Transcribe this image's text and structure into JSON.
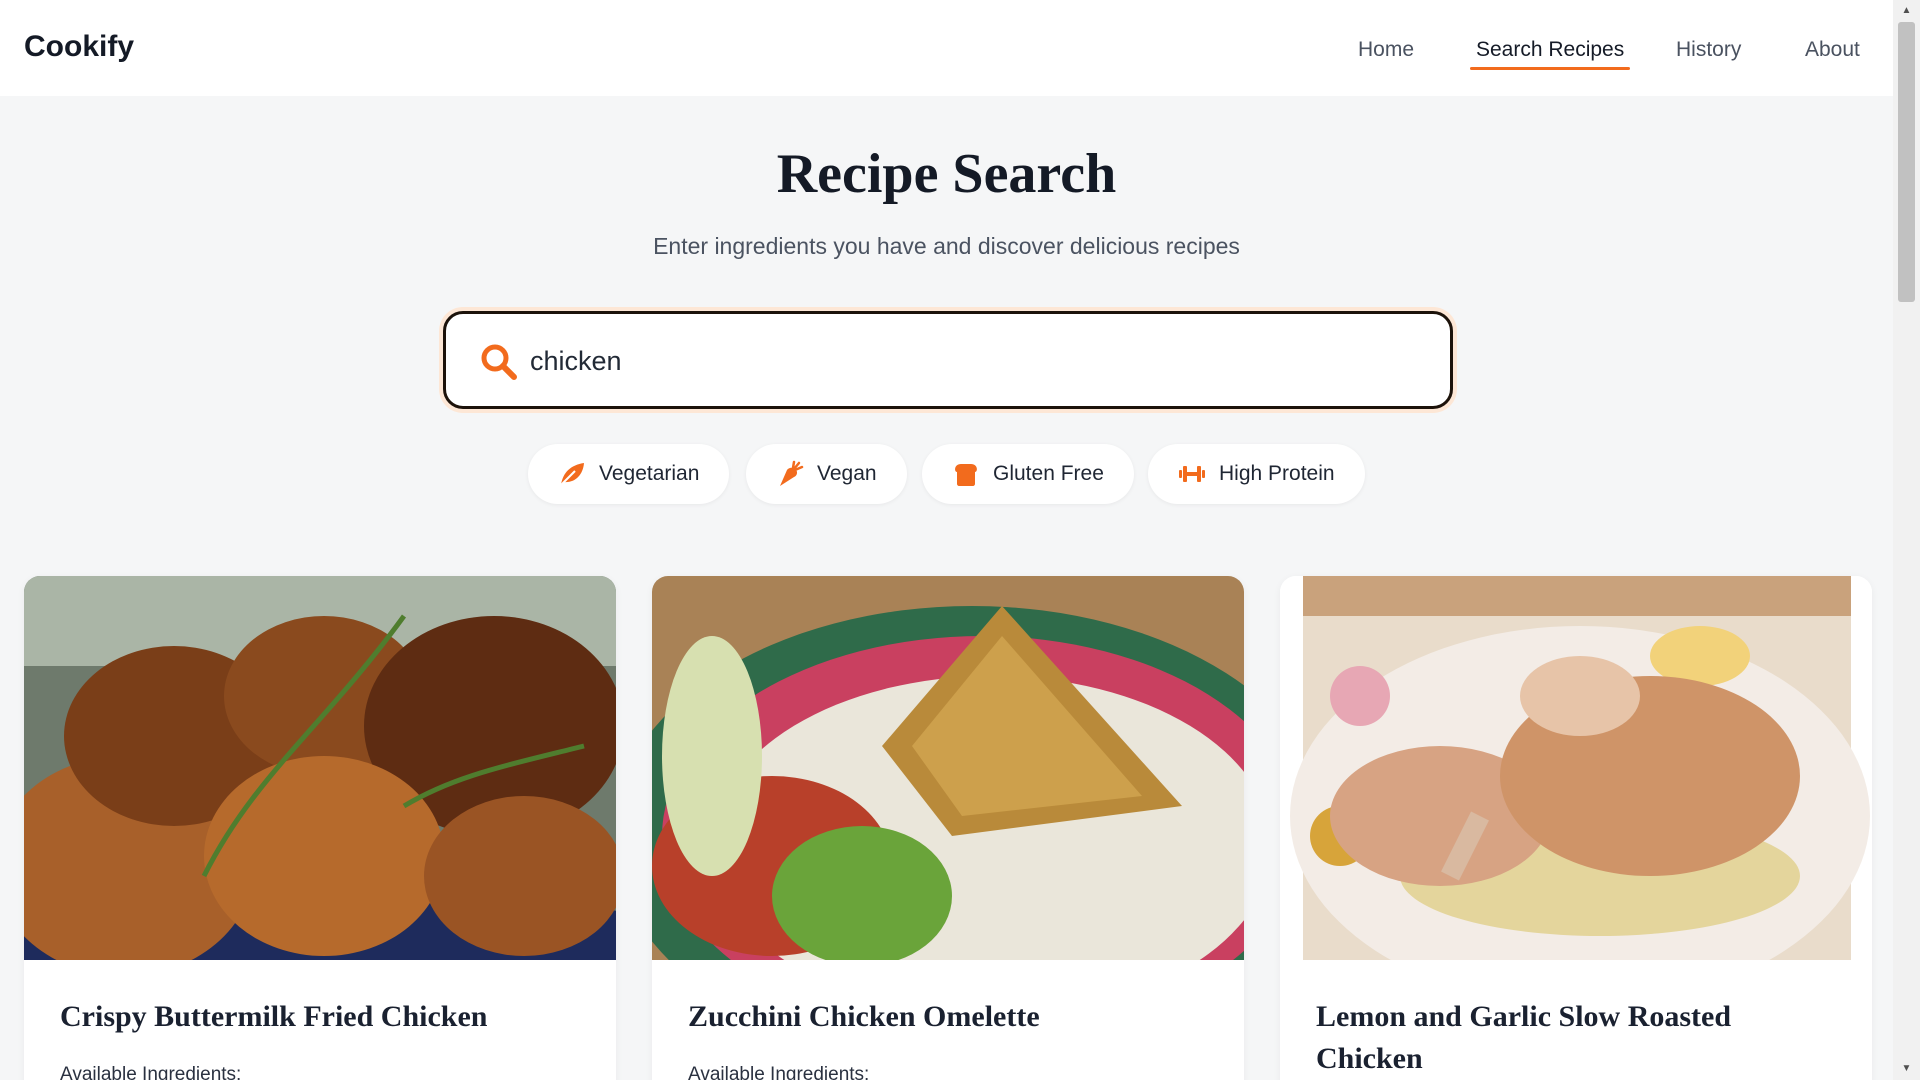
{
  "brand": "Cookify",
  "nav": {
    "items": [
      {
        "label": "Home",
        "active": false
      },
      {
        "label": "Search Recipes",
        "active": true
      },
      {
        "label": "History",
        "active": false
      },
      {
        "label": "About",
        "active": false
      }
    ]
  },
  "header": {
    "title": "Recipe Search",
    "subtitle": "Enter ingredients you have and discover delicious recipes"
  },
  "search": {
    "value": "chicken",
    "icon": "search-icon"
  },
  "filters": [
    {
      "label": "Vegetarian",
      "icon": "leaf-icon"
    },
    {
      "label": "Vegan",
      "icon": "carrot-icon"
    },
    {
      "label": "Gluten Free",
      "icon": "bread-icon"
    },
    {
      "label": "High Protein",
      "icon": "dumbbell-icon"
    }
  ],
  "recipes": [
    {
      "title": "Crispy Buttermilk Fried Chicken",
      "ingredients_label": "Available Ingredients:"
    },
    {
      "title": "Zucchini Chicken Omelette",
      "ingredients_label": "Available Ingredients:"
    },
    {
      "title": "Lemon and Garlic Slow Roasted Chicken",
      "ingredients_label": ""
    }
  ],
  "colors": {
    "accent": "#f26b1d",
    "background": "#f5f6f7",
    "text": "#141a26"
  }
}
